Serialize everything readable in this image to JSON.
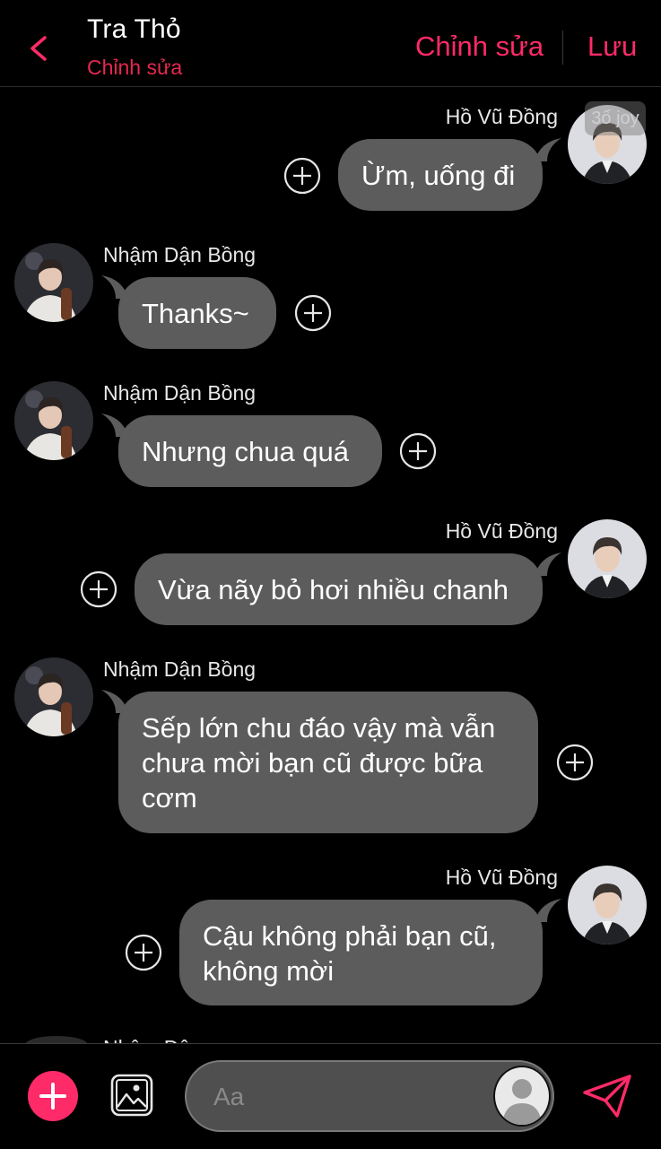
{
  "header": {
    "title": "Tra Thỏ",
    "subtitle": "Chỉnh sửa",
    "edit_label": "Chỉnh sửa",
    "save_label": "Lưu"
  },
  "colors": {
    "accent": "#ff2a68",
    "bubble": "#5c5c5c",
    "background": "#000000"
  },
  "watermark": "3ố joy",
  "messages": [
    {
      "sender": "Hồ Vũ Đồng",
      "side": "right",
      "text": "Ừm, uống đi"
    },
    {
      "sender": "Nhậm Dận Bồng",
      "side": "left",
      "text": "Thanks~"
    },
    {
      "sender": "Nhậm Dận Bồng",
      "side": "left",
      "text": "Nhưng chua quá"
    },
    {
      "sender": "Hồ Vũ Đồng",
      "side": "right",
      "text": "Vừa nãy bỏ hơi nhiều chanh"
    },
    {
      "sender": "Nhậm Dận Bồng",
      "side": "left",
      "text": "Sếp lớn chu đáo vậy mà vẫn chưa mời bạn cũ được bữa cơm"
    },
    {
      "sender": "Hồ Vũ Đồng",
      "side": "right",
      "text": "Cậu không phải bạn cũ, không mời"
    }
  ],
  "partial_sender": "Nhậm Dận Bồng",
  "composer": {
    "placeholder": "Aa",
    "value": ""
  },
  "icons": {
    "back": "chevron-left-icon",
    "add": "plus-icon",
    "image": "image-icon",
    "send": "send-icon",
    "add_reaction": "plus-circle-icon"
  }
}
